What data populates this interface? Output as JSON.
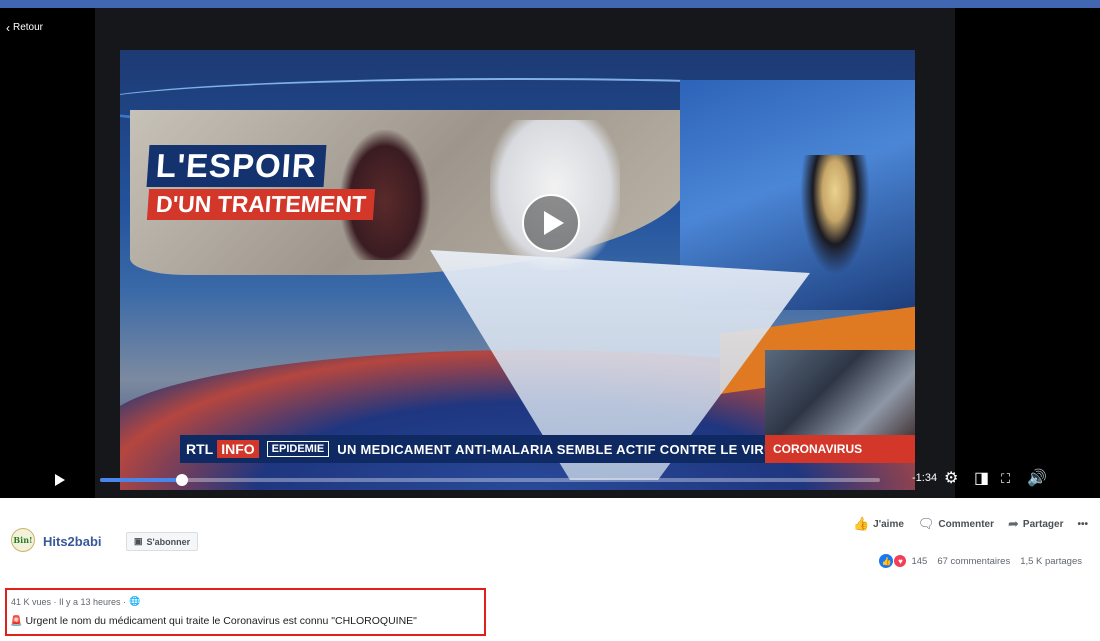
{
  "player": {
    "back_label": "Retour",
    "headline_line1": "L'ESPOIR",
    "headline_line2": "D'UN TRAITEMENT",
    "ticker_brand": "RTL",
    "ticker_brand_info": "INFO",
    "ticker_tag": "EPIDEMIE",
    "ticker_text": "UN MEDICAMENT ANTI-MALARIA SEMBLE ACTIF CONTRE LE VIRUS",
    "ticker_corner": "CORONAVIRUS",
    "time_remaining": "-1:34",
    "progress_fraction": 0.105
  },
  "post": {
    "page_name": "Hits2babi",
    "logo_text": "Bin!",
    "follow_label": "S'abonner",
    "actions": {
      "like": "J'aime",
      "comment": "Commenter",
      "share": "Partager",
      "more": "•••"
    },
    "stats": {
      "reactions": "145",
      "comments": "67 commentaires",
      "shares": "1,5 K partages"
    },
    "meta": "41 K vues · Il y a 13 heures ·",
    "caption": "Urgent le nom du médicament qui traite le Coronavirus est connu \"CHLOROQUINE\""
  }
}
